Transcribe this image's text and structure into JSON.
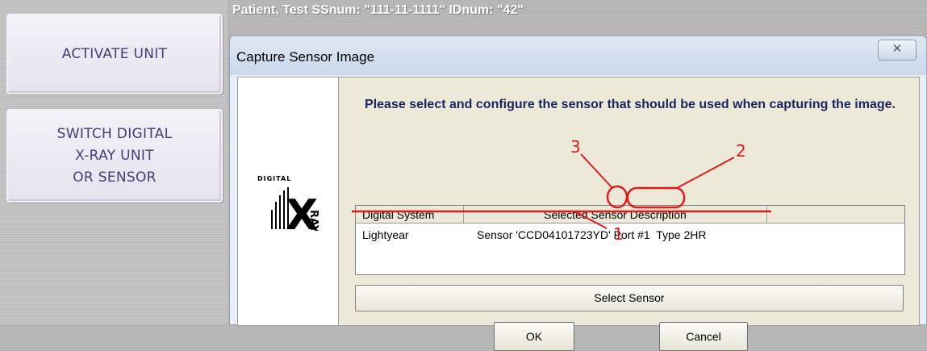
{
  "sidebar": {
    "activate_label": "ACTIVATE UNIT",
    "switch_label": "SWITCH DIGITAL\nX-RAY UNIT\nOR SENSOR"
  },
  "patient_bar": {
    "text": "Patient, Test  SSnum: \"111-11-1111\"  IDnum: \"42\""
  },
  "dialog": {
    "title": "Capture Sensor Image",
    "close_glyph": "✕",
    "prompt": "Please select and configure the sensor that should be used when capturing the image.",
    "logo": {
      "top_text": "DIGITAL",
      "side_text": "RAY",
      "letter": "X"
    },
    "table": {
      "headers": [
        "Digital System",
        "Selected Sensor Description",
        ""
      ],
      "rows": [
        {
          "system": "Lightyear",
          "description": "Sensor 'CCD04101723YD' Port #1  Type 2HR"
        }
      ]
    },
    "select_sensor_label": "Select Sensor",
    "ok_label": "OK",
    "cancel_label": "Cancel"
  },
  "annotations": {
    "color": "#e01b1b",
    "labels": [
      "1",
      "2",
      "3"
    ]
  }
}
